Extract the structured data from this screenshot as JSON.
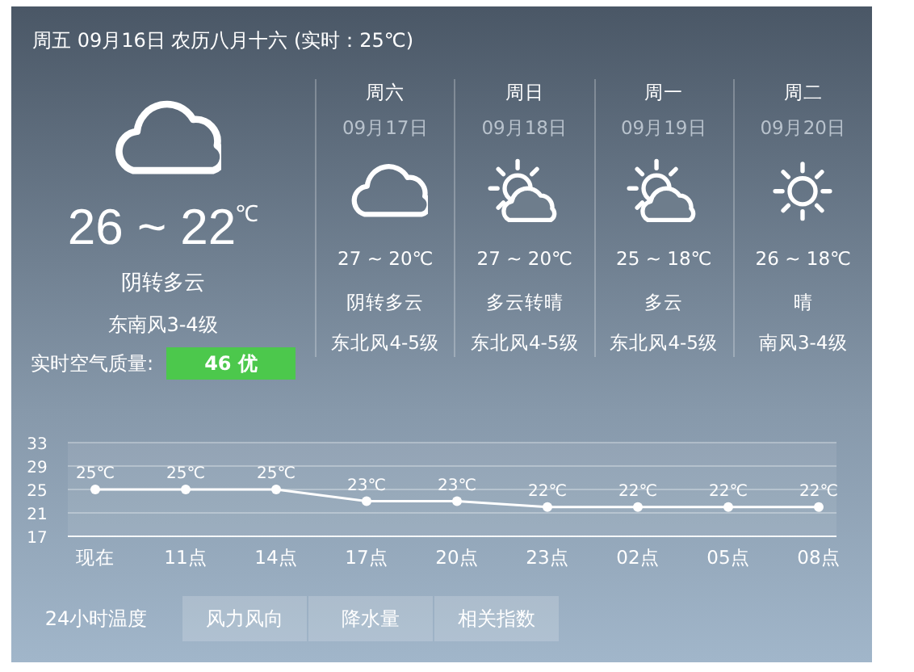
{
  "header": {
    "text": "周五 09月16日 农历八月十六 (实时：25℃)"
  },
  "today": {
    "kind": "cloudy",
    "temp": "26 ~ 22",
    "unit": "℃",
    "weather": "阴转多云",
    "wind": "东南风3-4级",
    "aqi_label": "实时空气质量:",
    "aqi": {
      "text": "46 优",
      "color": "#4cc84c"
    }
  },
  "forecast": [
    {
      "day": "周六",
      "date": "09月17日",
      "kind": "cloudy",
      "temp": "27 ~ 20℃",
      "weather": "阴转多云",
      "wind": "东北风4-5级"
    },
    {
      "day": "周日",
      "date": "09月18日",
      "kind": "partly_cloudy",
      "temp": "27 ~ 20℃",
      "weather": "多云转晴",
      "wind": "东北风4-5级"
    },
    {
      "day": "周一",
      "date": "09月19日",
      "kind": "partly_cloudy",
      "temp": "25 ~ 18℃",
      "weather": "多云",
      "wind": "东北风4-5级"
    },
    {
      "day": "周二",
      "date": "09月20日",
      "kind": "sunny",
      "temp": "26 ~ 18℃",
      "weather": "晴",
      "wind": "南风3-4级"
    }
  ],
  "chart": {
    "chart_data": {
      "type": "line",
      "categories": [
        "现在",
        "11点",
        "14点",
        "17点",
        "20点",
        "23点",
        "02点",
        "05点",
        "08点"
      ],
      "grid": true,
      "series": [
        {
          "color": "#ffffff",
          "marker": true,
          "values": [
            25,
            25,
            25,
            23,
            23,
            22,
            22,
            22,
            22
          ]
        }
      ],
      "ylim": [
        17,
        33
      ],
      "yticks": [
        17,
        21,
        25,
        29,
        33
      ],
      "value_labels": [
        "25℃",
        "25℃",
        "25℃",
        "23℃",
        "23℃",
        "22℃",
        "22℃",
        "22℃",
        "22℃"
      ]
    }
  },
  "tabs": [
    {
      "label": "24小时温度",
      "selected": true
    },
    {
      "label": "风力风向",
      "selected": false
    },
    {
      "label": "降水量",
      "selected": false
    },
    {
      "label": "相关指数",
      "selected": false
    }
  ]
}
